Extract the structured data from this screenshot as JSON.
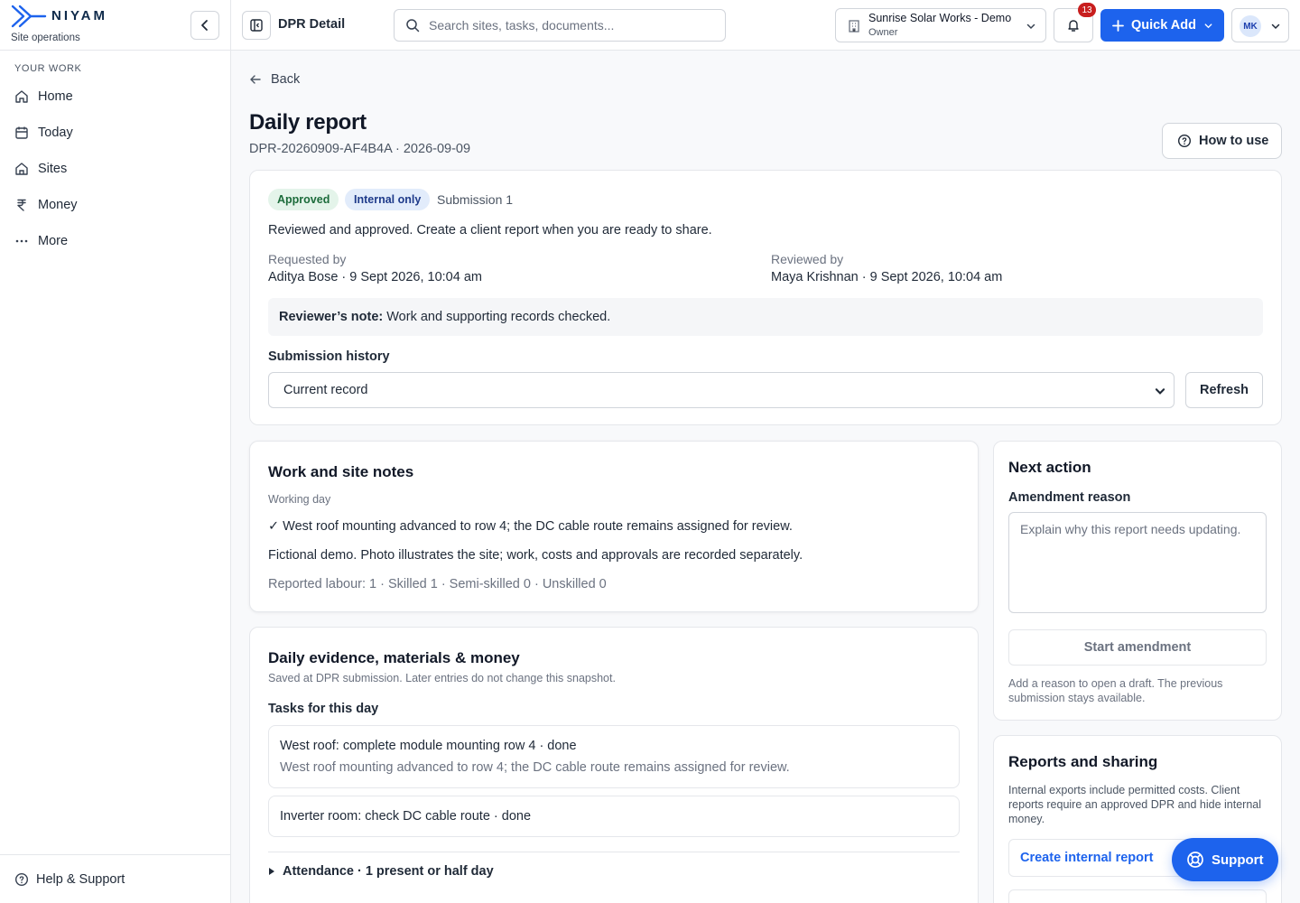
{
  "brand": {
    "name": "NIYAM",
    "subtitle": "Site operations"
  },
  "sidebar": {
    "section_label": "YOUR WORK",
    "items": [
      {
        "label": "Home",
        "icon": "home-icon"
      },
      {
        "label": "Today",
        "icon": "calendar-icon"
      },
      {
        "label": "Sites",
        "icon": "building-icon"
      },
      {
        "label": "Money",
        "icon": "rupee-icon"
      },
      {
        "label": "More",
        "icon": "more-icon"
      }
    ],
    "footer_label": "Help & Support"
  },
  "topbar": {
    "page_label": "DPR Detail",
    "search_placeholder": "Search sites, tasks, documents...",
    "org_name": "Sunrise Solar Works - Demo",
    "org_role": "Owner",
    "notification_count": "13",
    "quick_add_label": "Quick Add",
    "avatar_initials": "MK"
  },
  "page": {
    "back_label": "Back",
    "title": "Daily report",
    "subtitle": "DPR-20260909-AF4B4A · 2026-09-09",
    "how_to_label": "How to use"
  },
  "status": {
    "approved_badge": "Approved",
    "internal_badge": "Internal only",
    "submission": "Submission 1",
    "message": "Reviewed and approved. Create a client report when you are ready to share.",
    "requested_label": "Requested by",
    "requested_value": "Aditya Bose · 9 Sept 2026, 10:04 am",
    "reviewed_label": "Reviewed by",
    "reviewed_value": "Maya Krishnan · 9 Sept 2026, 10:04 am",
    "note_label": "Reviewer’s note:",
    "note_text": "Work and supporting records checked.",
    "history_label": "Submission history",
    "history_selected": "Current record",
    "refresh_label": "Refresh"
  },
  "work": {
    "title": "Work and site notes",
    "day_type": "Working day",
    "progress": "✓ West roof mounting advanced to row 4; the DC cable route remains assigned for review.",
    "disclaimer": "Fictional demo. Photo illustrates the site; work, costs and approvals are recorded separately.",
    "labour": "Reported labour: 1 · Skilled 1 · Semi-skilled 0 · Unskilled 0"
  },
  "evidence": {
    "title": "Daily evidence, materials & money",
    "subtitle": "Saved at DPR submission. Later entries do not change this snapshot.",
    "tasks_label": "Tasks for this day",
    "tasks": [
      {
        "title": "West roof: complete module mounting row 4 · done",
        "detail": "West roof mounting advanced to row 4; the DC cable route remains assigned for review."
      },
      {
        "title": "Inverter room: check DC cable route · done",
        "detail": ""
      }
    ],
    "attendance_label": "Attendance · 1 present or half day"
  },
  "next_action": {
    "title": "Next action",
    "amend_label": "Amendment reason",
    "amend_placeholder": "Explain why this report needs updating.",
    "start_label": "Start amendment",
    "hint": "Add a reason to open a draft. The previous submission stays available."
  },
  "reports": {
    "title": "Reports and sharing",
    "description": "Internal exports include permitted costs. Client reports require an approved DPR and hide internal money.",
    "internal_label": "Create internal report"
  },
  "support_label": "Support",
  "colors": {
    "accent": "#1d63ed",
    "approved_bg": "#e4f4ea",
    "approved_fg": "#1b6b3a",
    "internal_bg": "#e2ecfb",
    "badge_red": "#c81e1e"
  }
}
